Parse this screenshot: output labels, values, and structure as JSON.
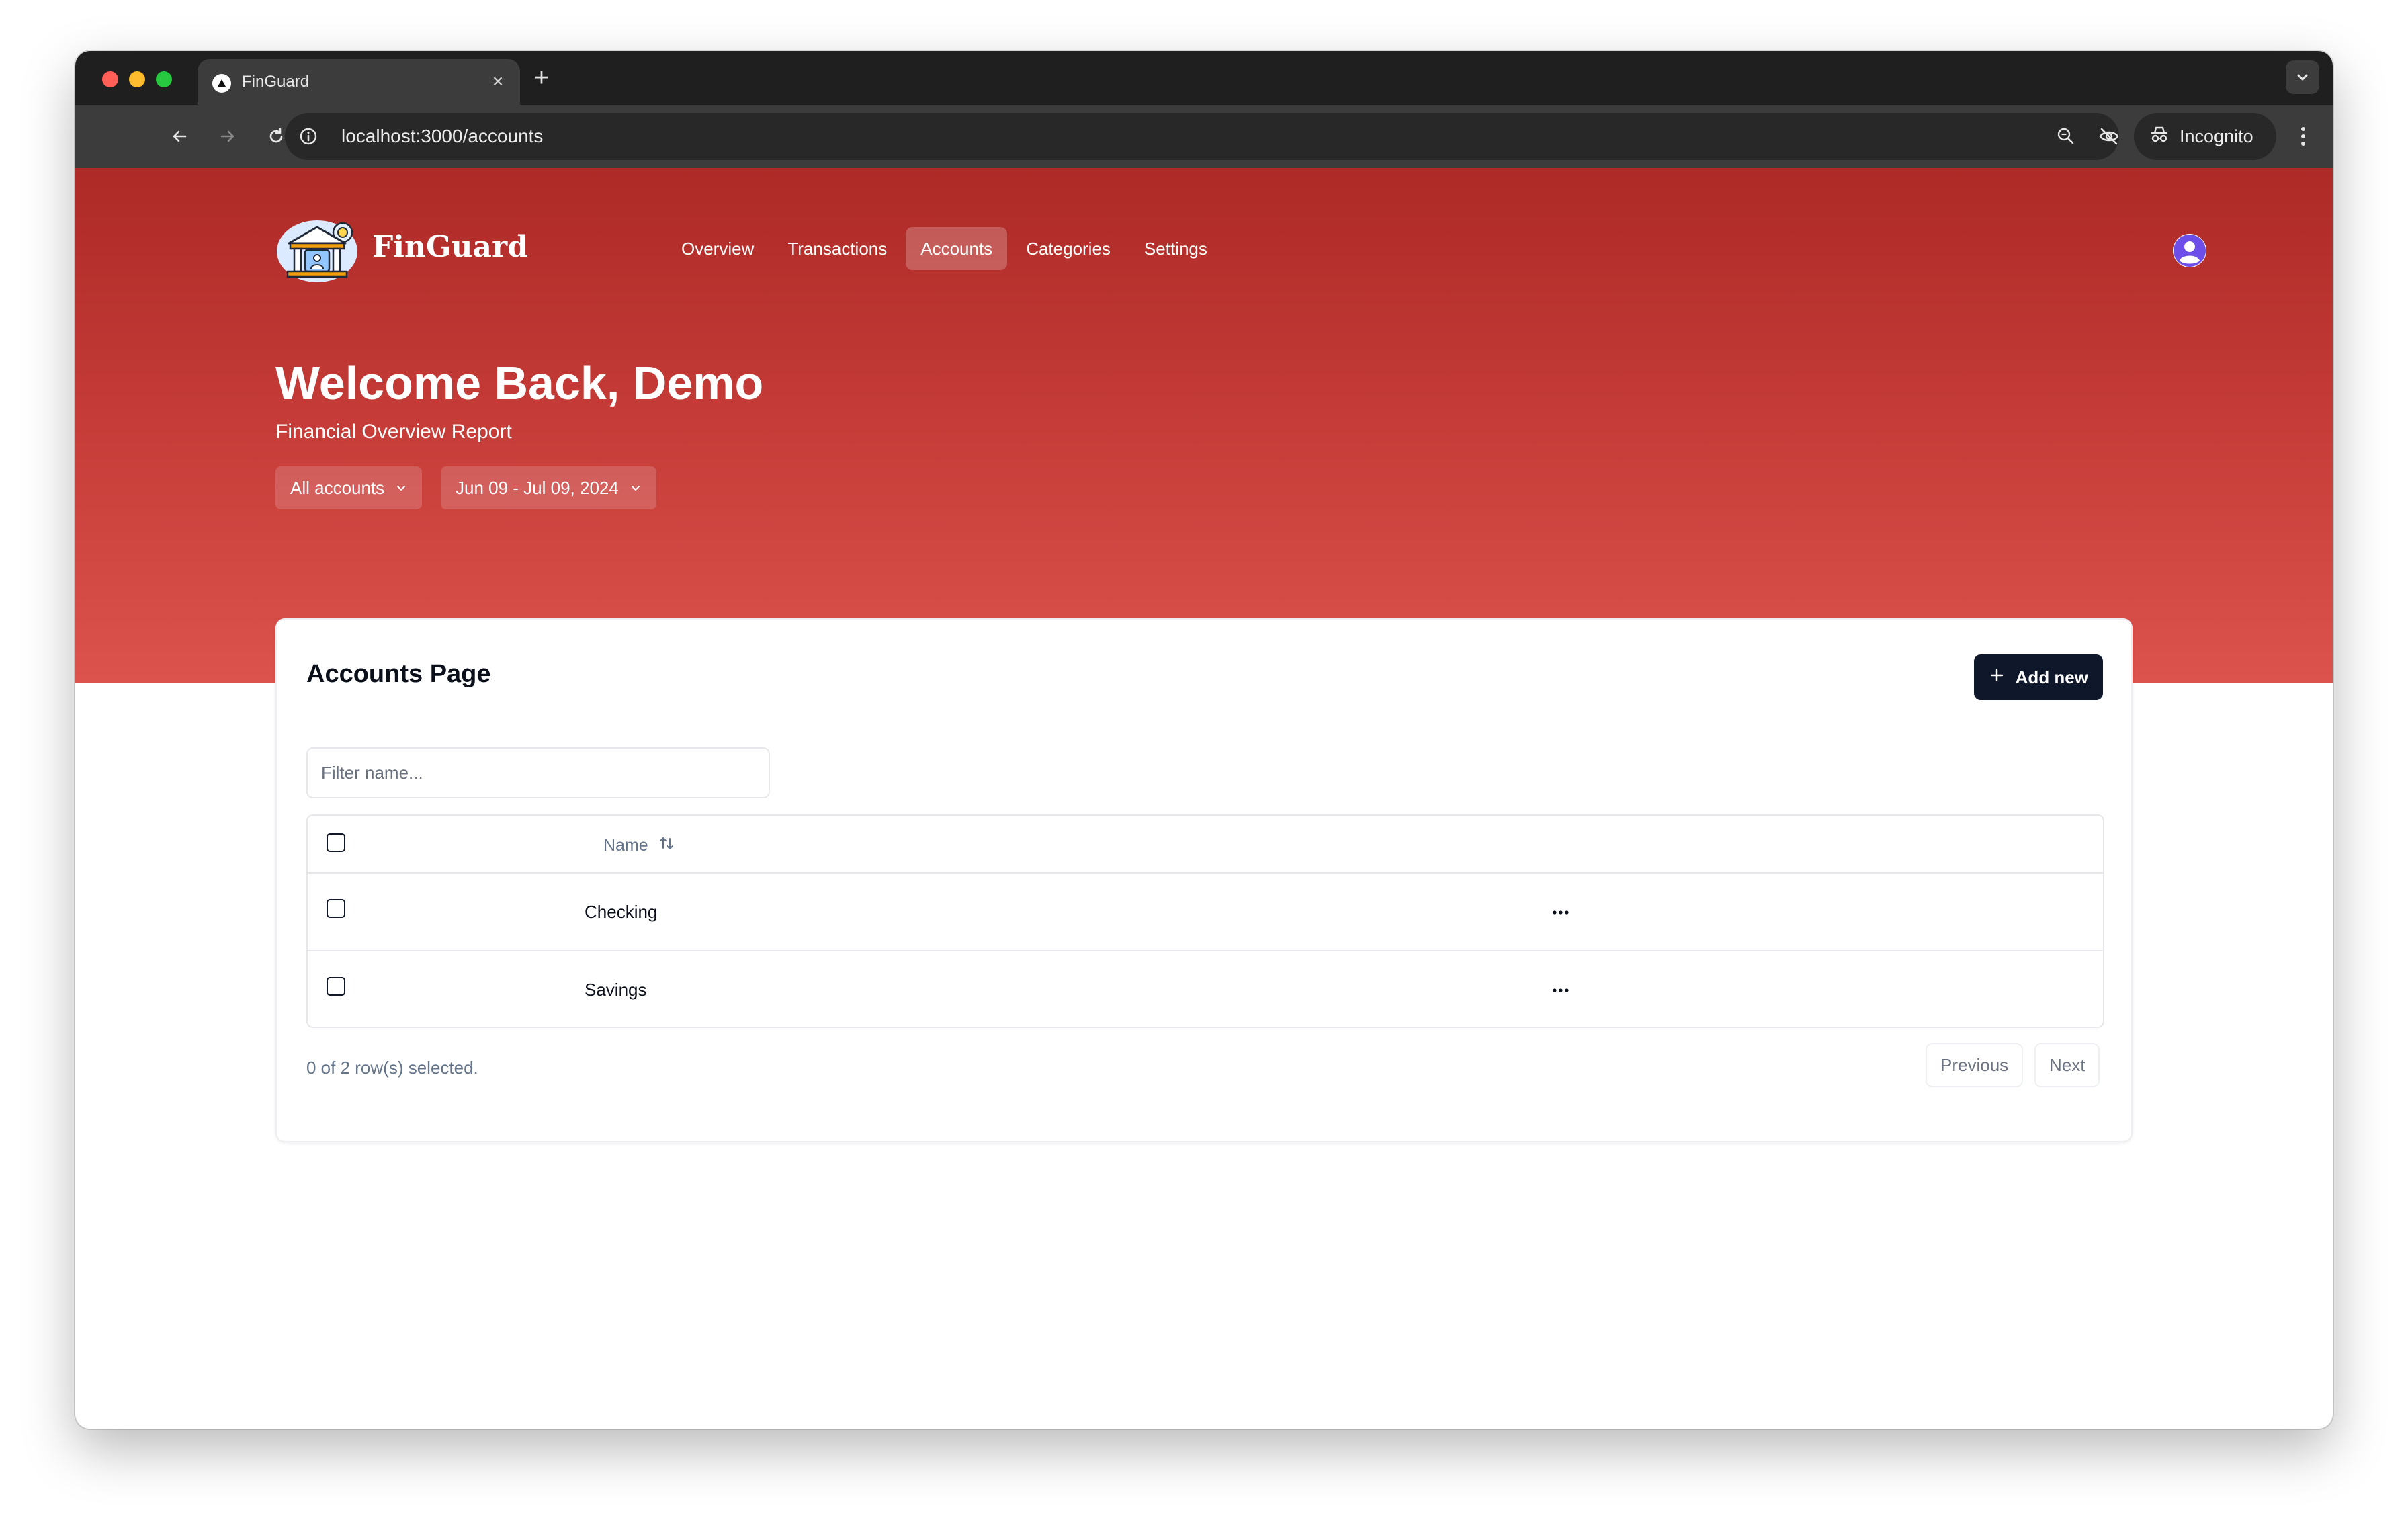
{
  "browser": {
    "tab_title": "FinGuard",
    "url": "localhost:3000/accounts",
    "incognito_label": "Incognito"
  },
  "app": {
    "brand": "FinGuard",
    "nav": [
      {
        "label": "Overview",
        "active": false
      },
      {
        "label": "Transactions",
        "active": false
      },
      {
        "label": "Accounts",
        "active": true
      },
      {
        "label": "Categories",
        "active": false
      },
      {
        "label": "Settings",
        "active": false
      }
    ],
    "welcome": "Welcome Back, Demo",
    "subtitle": "Financial Overview Report",
    "filters": {
      "accounts": "All accounts",
      "date_range": "Jun 09 - Jul 09, 2024"
    }
  },
  "card": {
    "title": "Accounts Page",
    "add_button": "Add new",
    "filter_placeholder": "Filter name...",
    "table": {
      "header_name": "Name",
      "rows": [
        {
          "name": "Checking",
          "selected": false
        },
        {
          "name": "Savings",
          "selected": false
        }
      ]
    },
    "selection_status": "0 of 2 row(s) selected.",
    "pagination": {
      "previous": "Previous",
      "next": "Next"
    }
  },
  "colors": {
    "hero_top": "#ad2a27",
    "hero_bottom": "#dc524c",
    "primary_button": "#0f172a",
    "avatar_accent": "#6d4ee8"
  }
}
